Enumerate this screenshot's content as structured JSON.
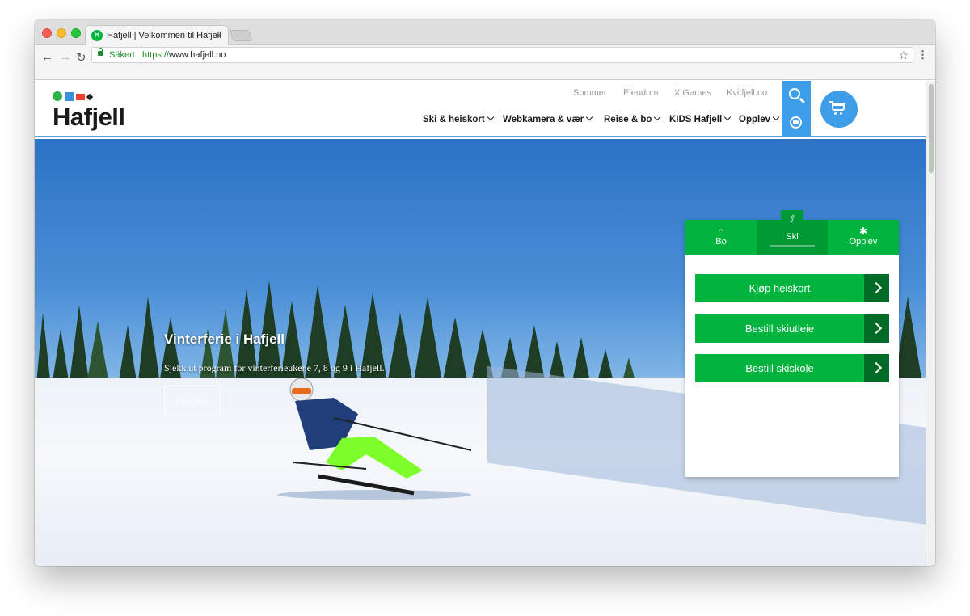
{
  "browser": {
    "tab_title": "Hafjell | Velkommen til Hafjell",
    "tab_favicon_letter": "H",
    "tab_close": "×",
    "security_label": "Säkert",
    "url_scheme": "https://",
    "url_host": "www.hafjell.no",
    "back_glyph": "←",
    "forward_glyph": "→",
    "reload_glyph": "↻",
    "bookmark_glyph": "☆",
    "menu_glyph": "⋮"
  },
  "header": {
    "logo_text": "Hafjell",
    "top_links": [
      "Sommer",
      "Eiendom",
      "X Games",
      "Kvitfjell.no"
    ],
    "main_nav": [
      "Ski & heiskort",
      "Webkamera & vær",
      "Reise & bo",
      "KIDS Hafjell",
      "Opplev"
    ]
  },
  "hero": {
    "title": "Vinterferie i Hafjell",
    "subtitle": "Sjekk ut program for vinterferieukene 7, 8 og 9 i Hafjell.",
    "button_label": "Les mer"
  },
  "widget": {
    "tabs": [
      {
        "icon": "⌂",
        "label": "Bo"
      },
      {
        "icon": "",
        "label": "Ski"
      },
      {
        "icon": "✱",
        "label": "Opplev"
      }
    ],
    "ski_icon_glyph": "⫽",
    "active_tab": "Ski",
    "buttons": [
      "Kjøp heiskort",
      "Bestill skiutleie",
      "Bestill skiskole"
    ]
  },
  "colors": {
    "brand_green": "#00b43e",
    "brand_blue": "#3d9de8",
    "arrow_dark_green": "#006b26"
  }
}
